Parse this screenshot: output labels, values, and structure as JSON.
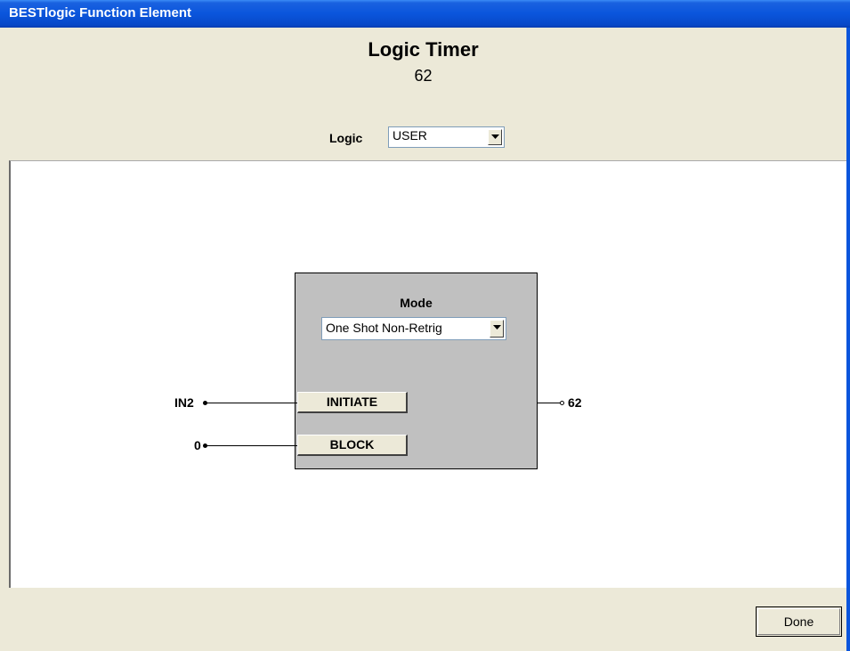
{
  "window": {
    "title": "BESTlogic Function Element"
  },
  "header": {
    "title": "Logic Timer",
    "number": "62",
    "logic_label": "Logic",
    "logic_value": "USER"
  },
  "block": {
    "mode_label": "Mode",
    "mode_value": "One Shot Non-Retrig",
    "initiate_label": "INITIATE",
    "block_label": "BLOCK"
  },
  "inputs": {
    "initiate_source": "IN2",
    "block_source": "0"
  },
  "output": {
    "label": "62"
  },
  "footer": {
    "done_label": "Done"
  },
  "colors": {
    "titlebar": "#0a55dc",
    "dialog_bg": "#ece9d8",
    "block_bg": "#c0c0c0"
  },
  "icons": {
    "dropdown": "chevron-down-icon"
  }
}
